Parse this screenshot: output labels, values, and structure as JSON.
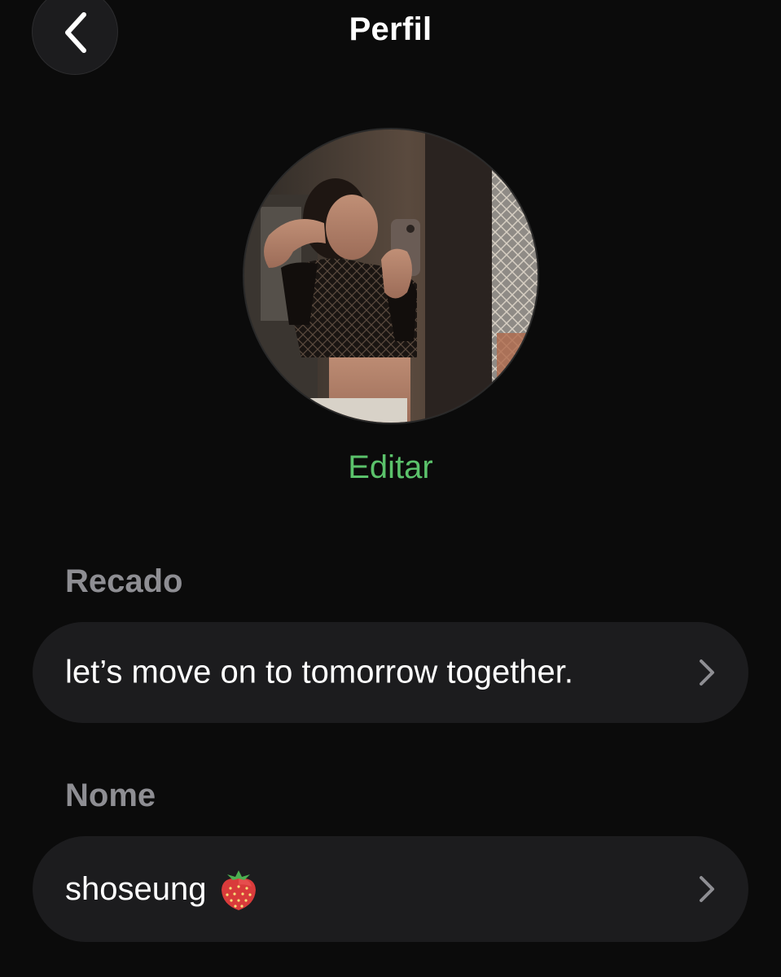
{
  "header": {
    "title": "Perfil",
    "back_icon": "chevron-left-icon"
  },
  "avatar": {
    "edit_label": "Editar",
    "accent_color": "#5bc26b"
  },
  "status_section": {
    "label": "Recado",
    "value": "let’s move on to tomorrow together.",
    "chevron_icon": "chevron-right-icon"
  },
  "name_section": {
    "label": "Nome",
    "value": "shoseung",
    "emoji_icon": "strawberry-icon",
    "chevron_icon": "chevron-right-icon"
  },
  "colors": {
    "background": "#0b0b0b",
    "card": "#1c1c1e",
    "label_gray": "#8e8e93"
  }
}
